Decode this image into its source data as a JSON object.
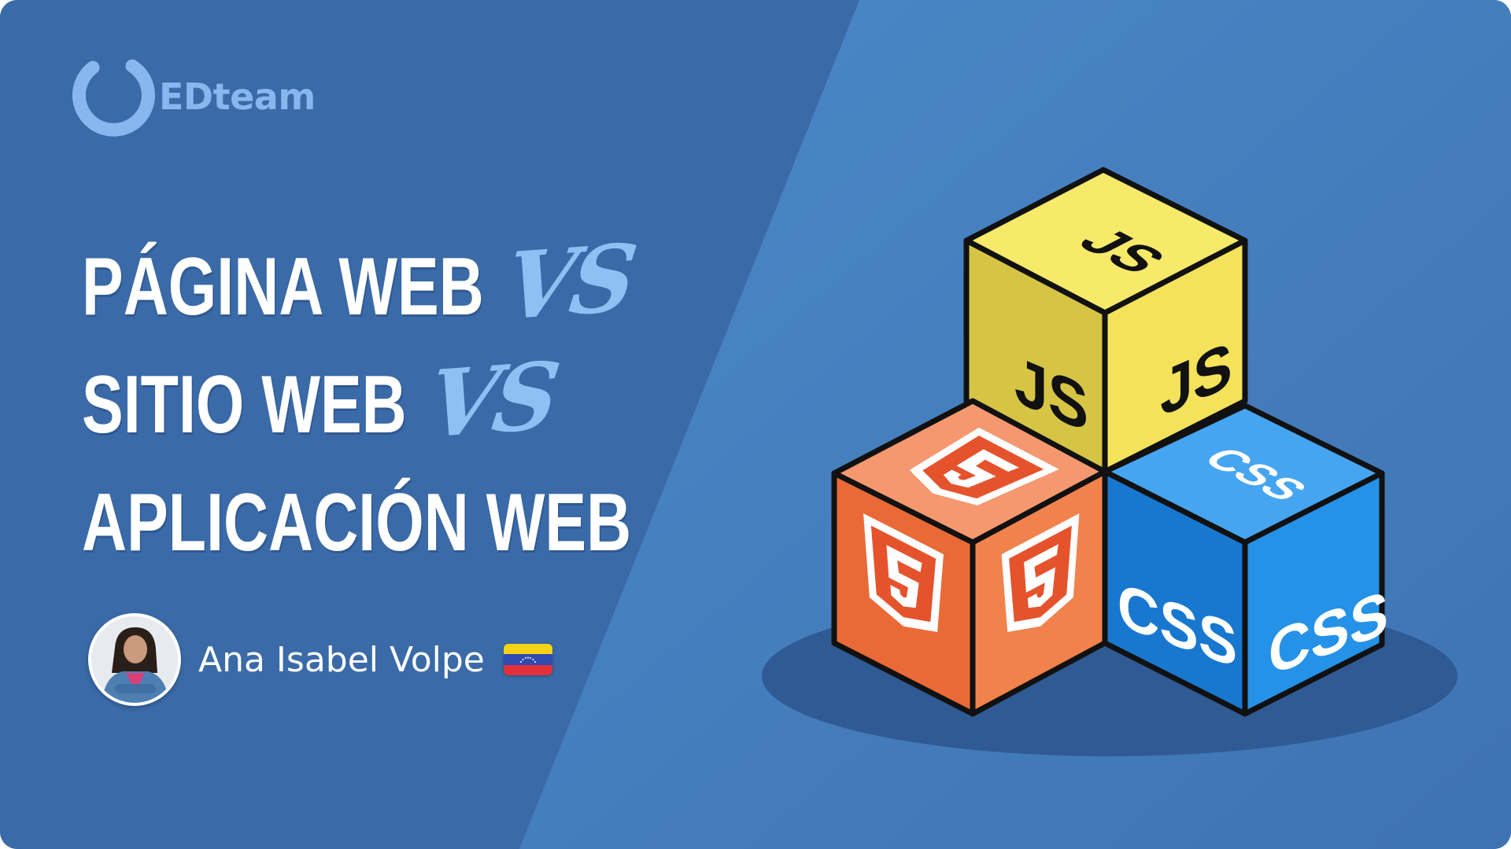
{
  "brand": {
    "name": "EDteam",
    "logo_icon": "edteam-ring-logo",
    "color": "#8ab6f0"
  },
  "title": {
    "line1": "PÁGINA WEB",
    "line2": "SITIO WEB",
    "line3": "APLICACIÓN WEB",
    "vs": "VS"
  },
  "author": {
    "name": "Ana Isabel Volpe",
    "flag_icon": "venezuela-flag-icon"
  },
  "cubes": {
    "js_label": "JS",
    "css_label": "CSS",
    "html_icon": "html5-shield-icon",
    "colors": {
      "js_top": "#f7e96a",
      "js_left": "#d6c445",
      "js_right": "#f3e25a",
      "css_top": "#46a5f1",
      "css_left": "#1878cf",
      "css_right": "#2592e8",
      "html_top": "#f59870",
      "html_left": "#ea6a37",
      "html_right": "#f2824c",
      "shadow": "#2f5a93"
    }
  },
  "colors": {
    "background_left": "#3a6aa7",
    "background_right": "#4a86c4",
    "title": "#ffffff",
    "vs": "#8fc0f3"
  }
}
